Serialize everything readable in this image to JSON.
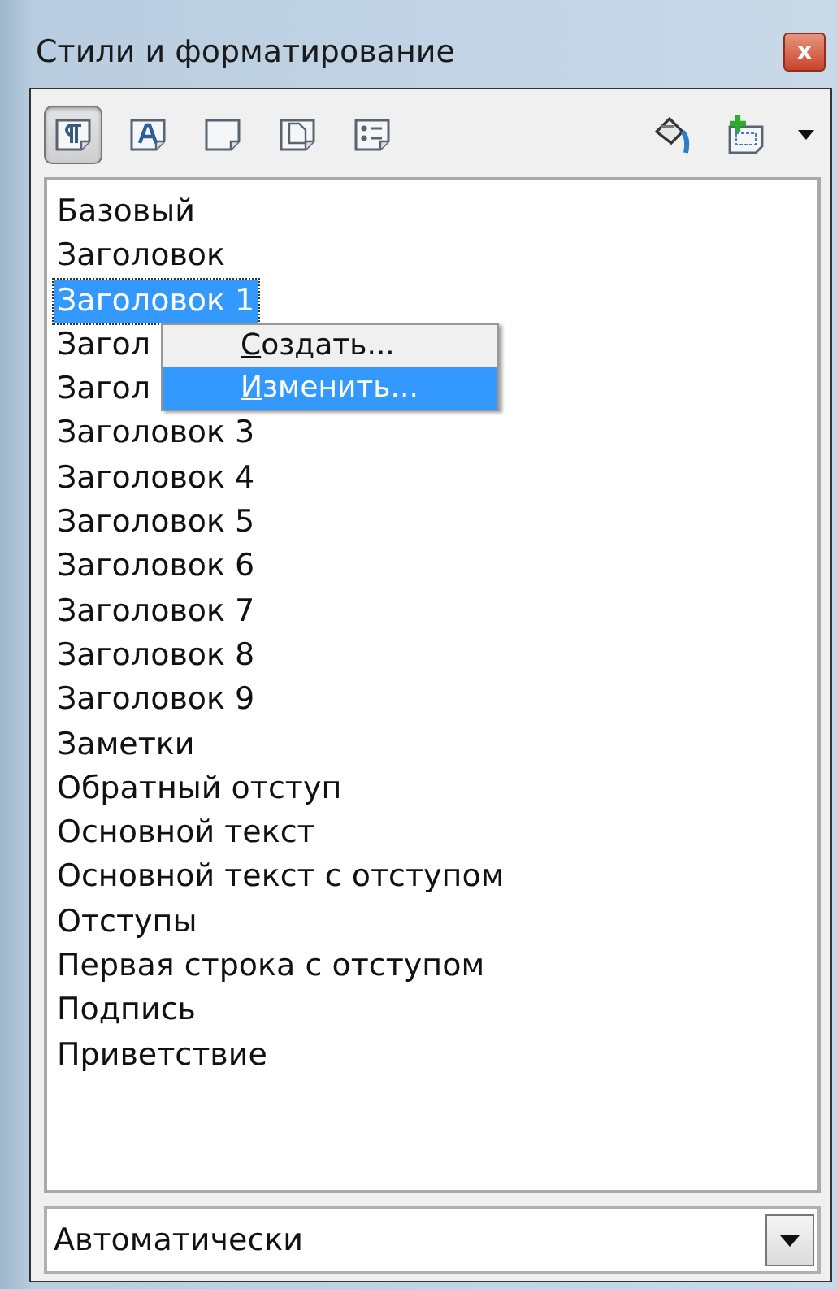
{
  "window": {
    "title": "Стили и форматирование",
    "close": "x"
  },
  "toolbar": {
    "style_types": [
      {
        "selected": true
      },
      {
        "selected": false
      },
      {
        "selected": false
      },
      {
        "selected": false
      },
      {
        "selected": false
      }
    ]
  },
  "styles": [
    {
      "label": "Базовый",
      "selected": false
    },
    {
      "label": "Заголовок",
      "selected": false
    },
    {
      "label": "Заголовок 1",
      "selected": true
    },
    {
      "label": "Загол",
      "selected": false
    },
    {
      "label": "Загол",
      "selected": false
    },
    {
      "label": "Заголовок 3",
      "selected": false
    },
    {
      "label": "Заголовок 4",
      "selected": false
    },
    {
      "label": "Заголовок 5",
      "selected": false
    },
    {
      "label": "Заголовок 6",
      "selected": false
    },
    {
      "label": "Заголовок 7",
      "selected": false
    },
    {
      "label": "Заголовок 8",
      "selected": false
    },
    {
      "label": "Заголовок 9",
      "selected": false
    },
    {
      "label": "Заметки",
      "selected": false
    },
    {
      "label": "Обратный отступ",
      "selected": false
    },
    {
      "label": "Основной текст",
      "selected": false
    },
    {
      "label": "Основной текст с отступом",
      "selected": false
    },
    {
      "label": "Отступы",
      "selected": false
    },
    {
      "label": "Первая строка с отступом",
      "selected": false
    },
    {
      "label": "Подпись",
      "selected": false
    },
    {
      "label": "Приветствие",
      "selected": false
    }
  ],
  "context_menu": [
    {
      "label": "Создать...",
      "selected": false
    },
    {
      "label": "Изменить...",
      "selected": true
    }
  ],
  "filter": {
    "value": "Автоматически"
  }
}
